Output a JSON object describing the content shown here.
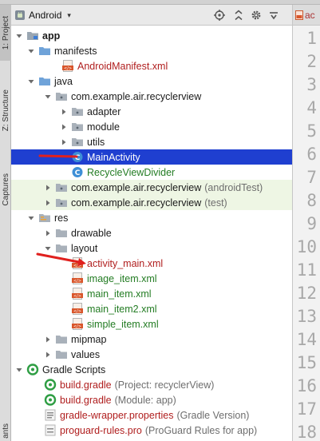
{
  "toolbar": {
    "view_label": "Android"
  },
  "editor": {
    "tab_label": "ac",
    "line_numbers": [
      "1",
      "2",
      "3",
      "4",
      "5",
      "6",
      "7",
      "8",
      "9",
      "10",
      "11",
      "12",
      "13",
      "14",
      "15",
      "16",
      "17",
      "18"
    ]
  },
  "side_tabs": {
    "project": "1: Project",
    "structure": "Z: Structure",
    "captures": "Captures",
    "variants": "ants"
  },
  "tree": {
    "app": "app",
    "manifests": "manifests",
    "android_manifest": "AndroidManifest.xml",
    "java": "java",
    "pkg_main": "com.example.air.recyclerview",
    "adapter": "adapter",
    "module": "module",
    "utils": "utils",
    "main_activity": "MainActivity",
    "recycle_view_divider": "RecycleViewDivider",
    "pkg_android_test": "com.example.air.recyclerview",
    "pkg_android_test_suffix": "(androidTest)",
    "pkg_test": "com.example.air.recyclerview",
    "pkg_test_suffix": "(test)",
    "res": "res",
    "drawable": "drawable",
    "layout": "layout",
    "activity_main": "activity_main.xml",
    "image_item": "image_item.xml",
    "main_item": "main_item.xml",
    "main_item2": "main_item2.xml",
    "simple_item": "simple_item.xml",
    "mipmap": "mipmap",
    "values": "values",
    "gradle_scripts": "Gradle Scripts",
    "build_gradle_project": "build.gradle",
    "build_gradle_project_suffix": "(Project: recyclerView)",
    "build_gradle_module": "build.gradle",
    "build_gradle_module_suffix": "(Module: app)",
    "gradle_wrapper": "gradle-wrapper.properties",
    "gradle_wrapper_suffix": "(Gradle Version)",
    "proguard": "proguard-rules.pro",
    "proguard_suffix": "(ProGuard Rules for app)"
  },
  "colors": {
    "selection": "#1f3fd0",
    "annotation_red": "#e0201e",
    "resource_red": "#b01e1e",
    "class_green": "#237c23"
  }
}
